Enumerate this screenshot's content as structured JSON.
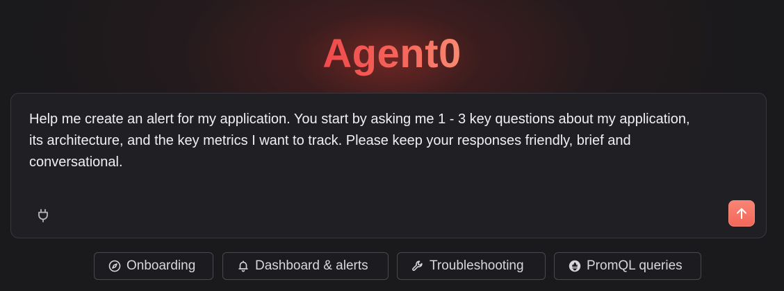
{
  "app": {
    "title": "Agent0"
  },
  "composer": {
    "prompt_value": "Help me create an alert for my application. You start by asking me 1 - 3 key questions about my application, its architecture, and the key metrics I want to track. Please keep your responses friendly, brief and conversational.",
    "plug_icon": "plug-icon",
    "send_icon": "arrow-up-icon"
  },
  "suggestions": [
    {
      "label": "Onboarding",
      "icon": "compass-icon"
    },
    {
      "label": "Dashboard & alerts",
      "icon": "bell-icon"
    },
    {
      "label": "Troubleshooting",
      "icon": "wrench-icon"
    },
    {
      "label": "PromQL queries",
      "icon": "prometheus-icon"
    }
  ],
  "colors": {
    "background": "#1a191c",
    "accent": "#f2685a",
    "title_gradient_start": "#ef4a4c",
    "title_gradient_end": "#f98a72"
  }
}
